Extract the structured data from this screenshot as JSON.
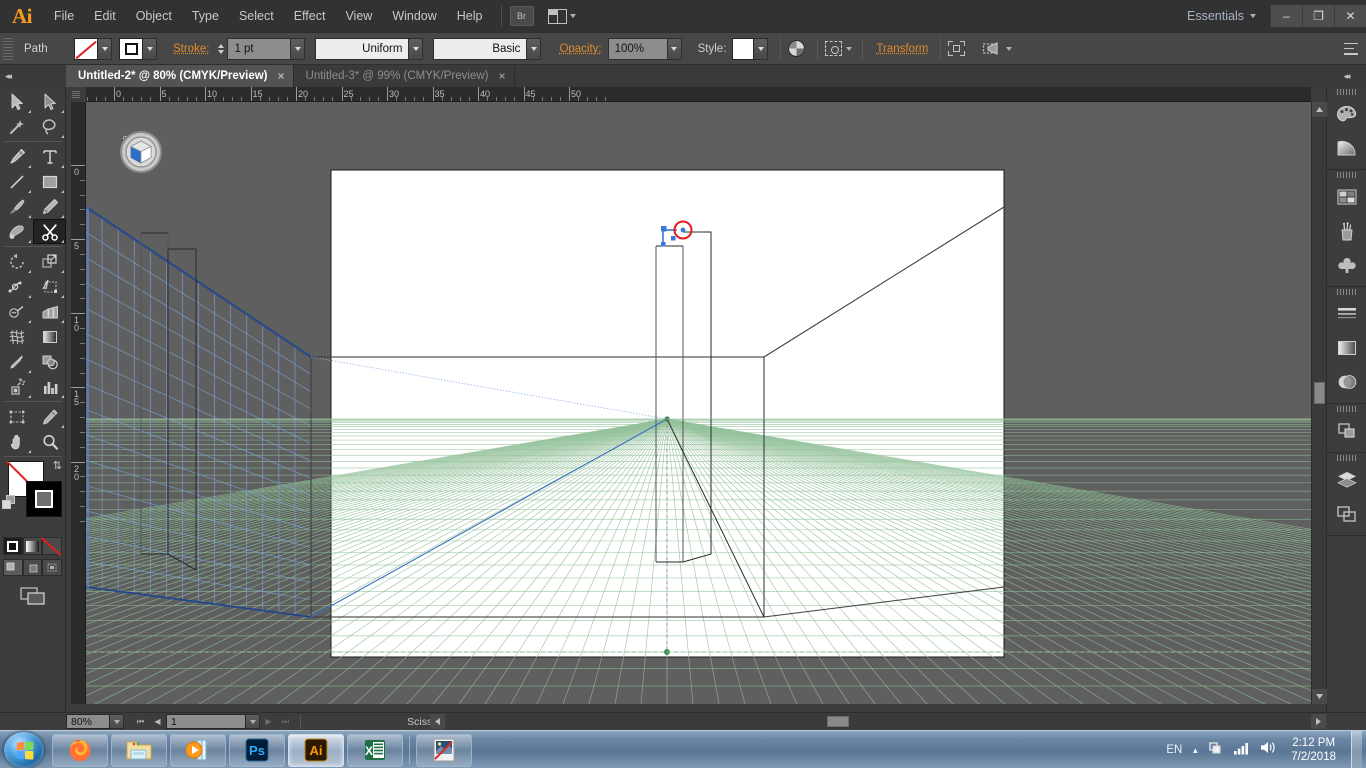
{
  "app": {
    "name": "Adobe Illustrator",
    "logo_text": "Ai",
    "workspace": "Essentials"
  },
  "menubar": {
    "items": [
      "File",
      "Edit",
      "Object",
      "Type",
      "Select",
      "Effect",
      "View",
      "Window",
      "Help"
    ],
    "bridge_label": "Br",
    "arrange_documents_icon": "arrange-documents-icon",
    "window_controls": {
      "minimize": "–",
      "restore": "❐",
      "close": "✕"
    }
  },
  "control_bar": {
    "object_label": "Path",
    "fill_swatch": "none",
    "stroke_swatch": "black",
    "stroke_label": "Stroke:",
    "stroke_weight": "1 pt",
    "profile_label": "Uniform",
    "brush_label": "Basic",
    "opacity_label": "Opacity:",
    "opacity_value": "100%",
    "style_label": "Style:",
    "style_swatch": "white",
    "recolor_icon": "recolor-artwork-icon",
    "align_icon": "align-options-icon",
    "transform_label": "Transform",
    "isolate_icon": "isolate-selected-icon",
    "pathfinder_icon": "pathfinder-icon",
    "overflow_icon": "panel-menu-icon"
  },
  "tabs": [
    {
      "label": "Untitled-2* @ 80% (CMYK/Preview)",
      "active": true,
      "close": "×"
    },
    {
      "label": "Untitled-3* @ 99% (CMYK/Preview)",
      "active": false,
      "close": "×"
    }
  ],
  "tools": {
    "selected": "Scissors",
    "items": [
      {
        "name": "selection-tool",
        "label": "Selection"
      },
      {
        "name": "direct-selection-tool",
        "label": "Direct Selection"
      },
      {
        "name": "magic-wand-tool",
        "label": "Magic Wand"
      },
      {
        "name": "lasso-tool",
        "label": "Lasso"
      },
      {
        "name": "pen-tool",
        "label": "Pen"
      },
      {
        "name": "type-tool",
        "label": "Type"
      },
      {
        "name": "line-segment-tool",
        "label": "Line Segment"
      },
      {
        "name": "rectangle-tool",
        "label": "Rectangle"
      },
      {
        "name": "paintbrush-tool",
        "label": "Paintbrush"
      },
      {
        "name": "pencil-tool",
        "label": "Pencil"
      },
      {
        "name": "blob-brush-tool",
        "label": "Blob Brush"
      },
      {
        "name": "scissors-tool",
        "label": "Scissors"
      },
      {
        "name": "rotate-tool",
        "label": "Rotate"
      },
      {
        "name": "scale-tool",
        "label": "Scale"
      },
      {
        "name": "width-tool",
        "label": "Width"
      },
      {
        "name": "free-transform-tool",
        "label": "Free Transform"
      },
      {
        "name": "shape-builder-tool",
        "label": "Shape Builder"
      },
      {
        "name": "perspective-grid-tool",
        "label": "Perspective Grid"
      },
      {
        "name": "mesh-tool",
        "label": "Mesh"
      },
      {
        "name": "gradient-tool",
        "label": "Gradient"
      },
      {
        "name": "eyedropper-tool",
        "label": "Eyedropper"
      },
      {
        "name": "blend-tool",
        "label": "Blend"
      },
      {
        "name": "symbol-sprayer-tool",
        "label": "Symbol Sprayer"
      },
      {
        "name": "column-graph-tool",
        "label": "Column Graph"
      },
      {
        "name": "artboard-tool",
        "label": "Artboard"
      },
      {
        "name": "slice-tool",
        "label": "Slice"
      },
      {
        "name": "hand-tool",
        "label": "Hand"
      },
      {
        "name": "zoom-tool",
        "label": "Zoom"
      }
    ],
    "fill_color": "#ffffff",
    "fill_is_none": true,
    "stroke_color": "#000000",
    "color_modes": [
      "color",
      "gradient",
      "none"
    ],
    "drawing_modes": [
      "draw-normal",
      "draw-behind",
      "draw-inside"
    ],
    "screen_mode": "screen-mode"
  },
  "panels_dock": {
    "groups": [
      {
        "icons": [
          "color-panel-icon",
          "color-guide-panel-icon"
        ]
      },
      {
        "icons": [
          "swatches-panel-icon",
          "brushes-panel-icon",
          "symbols-panel-icon"
        ]
      },
      {
        "icons": [
          "stroke-panel-icon",
          "gradient-panel-icon",
          "transparency-panel-icon"
        ]
      },
      {
        "icons": [
          "pathfinder-panel-icon"
        ]
      },
      {
        "icons": [
          "layers-panel-icon",
          "artboards-panel-icon"
        ]
      }
    ],
    "collapse_label": "◂◂"
  },
  "rulers": {
    "unit": "in",
    "h_labels": [
      "0",
      "5",
      "10",
      "15",
      "20",
      "25",
      "30",
      "35",
      "40",
      "45",
      "50"
    ],
    "v_labels": [
      "0",
      "5",
      "10",
      "15",
      "20"
    ]
  },
  "canvas": {
    "widget": "perspective-plane-switching-widget",
    "cursor": "scissors-cut-point",
    "background": "#5f5f5f",
    "artboard_background": "#ffffff"
  },
  "status_bar": {
    "zoom_value": "80%",
    "page_value": "1",
    "tool_status": "Scissors",
    "first_label": "⏮",
    "prev_label": "◀",
    "next_label": "▶",
    "last_label": "⏭"
  },
  "taskbar": {
    "start_label": "Start",
    "apps": [
      {
        "name": "firefox",
        "label": "Mozilla Firefox",
        "active": false
      },
      {
        "name": "file-explorer",
        "label": "File Explorer",
        "active": false
      },
      {
        "name": "media-player",
        "label": "Windows Media Player",
        "active": false
      },
      {
        "name": "photoshop",
        "label": "Ps",
        "active": false
      },
      {
        "name": "illustrator",
        "label": "Ai",
        "active": true
      },
      {
        "name": "excel",
        "label": "X",
        "active": false
      },
      {
        "name": "paint",
        "label": "Paint",
        "active": false
      }
    ],
    "tray": {
      "language": "EN",
      "show_hidden": "▲",
      "action_center_icon": "action-center-icon",
      "network_icon": "network-signal-icon",
      "volume_icon": "volume-icon",
      "time": "2:12 PM",
      "date": "7/2/2018"
    }
  },
  "colors": {
    "chrome_dark": "#323232",
    "chrome_mid": "#3d3d3d",
    "chrome_light": "#474747",
    "accent_orange": "#e08a2e",
    "canvas_gray": "#5f5f5f",
    "grid_blue": "#6f9bd2",
    "grid_green": "#8fbf96",
    "grid_dark_blue": "#2a4f94",
    "cursor_red": "#e81919",
    "anchor_blue": "#3a77d9"
  }
}
